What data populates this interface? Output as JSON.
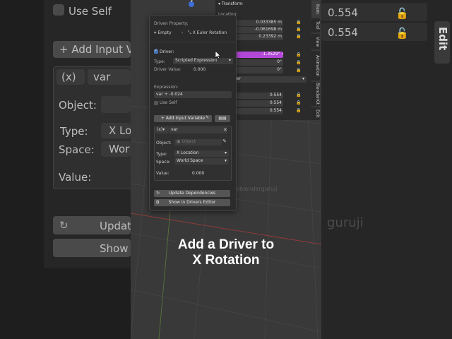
{
  "bg_left": {
    "use_self": "Use Self",
    "add_input": "+ Add Input V",
    "var_type": "(x)",
    "var_name": "var",
    "object_label": "Object:",
    "type_label": "Type:",
    "type_value": "X Lo",
    "space_label": "Space:",
    "space_value": "Wor",
    "value_label": "Value:",
    "update": "Updat",
    "show": "Show I"
  },
  "bg_right": {
    "v1": "0.554",
    "v2": "0.554",
    "edit_tab": "Edit"
  },
  "sidebar": {
    "transform_header": "Transform",
    "location_label": "Location:",
    "loc": [
      "0.033385 m",
      "-0.061698 m",
      "0.23392 m"
    ],
    "rot": [
      "-1.3529°",
      "0°",
      "0°"
    ],
    "mode_partial": "ler",
    "scale": [
      "0.554",
      "0.554",
      "0.554"
    ],
    "tabs": [
      "Item",
      "Tool",
      "View",
      "Animation",
      "BlenderKit",
      "Edit"
    ]
  },
  "popup": {
    "driven_property": "Driven Property:",
    "driven_object": "Empty",
    "driven_prop": "X Euler Rotation",
    "driver_label": "Driver:",
    "type_label": "Type:",
    "type_value": "Scripted Expression",
    "driver_value_label": "Driver Value:",
    "driver_value": "0.000",
    "expression_label": "Expression:",
    "expression": "var + -0.024",
    "use_self": "Use Self",
    "add_variable": "Add Input Variable",
    "var_type": "(x)",
    "var_name": "var",
    "object_label": "Object:",
    "object_placeholder": "Object",
    "var_type_label": "Type:",
    "var_type_value": "X Location",
    "space_label": "Space:",
    "space_value": "World Space",
    "value_label": "Value:",
    "value": "0.000",
    "update_deps": "Update Dependencies",
    "show_editor": "Show in Drivers Editor"
  },
  "watermark": "@theblenderguruji",
  "watermark_big": "guruji",
  "caption": {
    "line1": "Add a Driver to",
    "line2": "X Rotation"
  },
  "colors": {
    "accent": "#4772b3",
    "driver_purple": "#b347d8"
  }
}
